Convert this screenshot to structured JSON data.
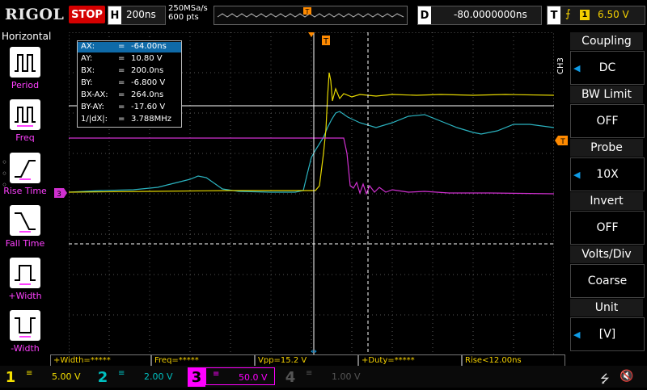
{
  "top": {
    "brand": "RIGOL",
    "run_state": "STOP",
    "timebase_label": "H",
    "timebase": "200ns",
    "sample_rate": "250MSa/s",
    "memory_depth": "600  pts",
    "delay_label": "D",
    "delay": "-80.0000000ns",
    "trigger_label": "T",
    "trigger_edge": "⨍",
    "trigger_source": "1",
    "trigger_level": "6.50 V"
  },
  "left": {
    "title": "Horizontal",
    "items": [
      {
        "label": "Period",
        "icon": "period-icon"
      },
      {
        "label": "Freq",
        "icon": "freq-icon"
      },
      {
        "label": "Rise Time",
        "icon": "rise-time-icon"
      },
      {
        "label": "Fall Time",
        "icon": "fall-time-icon"
      },
      {
        "label": "+Width",
        "icon": "positive-width-icon"
      },
      {
        "label": "-Width",
        "icon": "negative-width-icon"
      }
    ]
  },
  "cursors": {
    "rows": [
      {
        "k": "AX:",
        "v": "-64.00ns"
      },
      {
        "k": "AY:",
        "v": "10.80 V"
      },
      {
        "k": "BX:",
        "v": "200.0ns"
      },
      {
        "k": "BY:",
        "v": "-6.800 V"
      },
      {
        "k": "BX-AX:",
        "v": "264.0ns"
      },
      {
        "k": "BY-AY:",
        "v": "-17.60 V"
      },
      {
        "k": "1/|dX|:",
        "v": "3.788MHz"
      }
    ],
    "eq": "="
  },
  "markers": {
    "trigger_pos": "T",
    "ch3_level": "3",
    "trig_level": "T"
  },
  "right": {
    "channel": "CH3",
    "items": [
      {
        "header": "Coupling",
        "value": "DC"
      },
      {
        "header": "BW Limit",
        "value": "OFF"
      },
      {
        "header": "Probe",
        "value": "10X"
      },
      {
        "header": "Invert",
        "value": "OFF"
      },
      {
        "header": "Volts/Div",
        "value": "Coarse"
      },
      {
        "header": "Unit",
        "value": "[V]"
      }
    ]
  },
  "measurements": [
    "+Width=*****",
    "Freq=*****",
    "Vpp=15.2 V",
    "+Duty=*****",
    "Rise<12.00ns"
  ],
  "channels": [
    {
      "num": "1",
      "coupling": "≡",
      "scale": "5.00 V",
      "color": "#f4e000"
    },
    {
      "num": "2",
      "coupling": "≡",
      "scale": "2.00 V",
      "color": "#00c0c0"
    },
    {
      "num": "3",
      "coupling": "≡",
      "scale": "50.0 V",
      "color": "#ff00ff"
    },
    {
      "num": "4",
      "coupling": "≡",
      "scale": "1.00 V",
      "color": "#555555"
    }
  ],
  "colors": {
    "ch1": "#e6d800",
    "ch2": "#2bb3c0",
    "ch3": "#d030d0",
    "accent": "#0e9be6",
    "marker_orange": "#ff8a00"
  }
}
